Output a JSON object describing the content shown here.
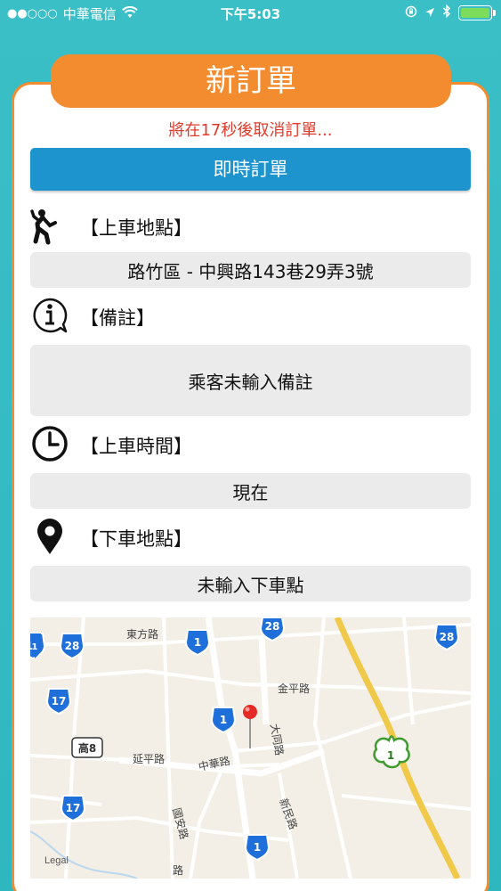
{
  "status_bar": {
    "signal": "●●○○○",
    "carrier": "中華電信",
    "time": "下午5:03"
  },
  "title": "新訂單",
  "countdown": "將在17秒後取消訂單...",
  "order_type": "即時訂單",
  "pickup": {
    "label": "【上車地點】",
    "value": "路竹區 - 中興路143巷29弄3號",
    "icon": "person-waving-icon"
  },
  "note": {
    "label": "【備註】",
    "value": "乘客未輸入備註",
    "icon": "info-icon"
  },
  "pickup_time": {
    "label": "【上車時間】",
    "value": "現在",
    "icon": "clock-icon"
  },
  "dropoff": {
    "label": "【下車地點】",
    "value": "未輸入下車點",
    "icon": "location-pin-icon"
  },
  "map": {
    "legal": "Legal",
    "roads": [
      "東方路",
      "金平路",
      "延平路",
      "中華路",
      "大同路",
      "新民路",
      "國安路",
      "路"
    ],
    "shields": [
      "17",
      "28",
      "1",
      "28",
      "28",
      "17",
      "1",
      "高8",
      "1",
      "17",
      "1",
      "1"
    ]
  },
  "colors": {
    "accent": "#f28c2e",
    "button": "#1e94cf",
    "warning": "#e03a2a",
    "background": "#3bbfc7"
  }
}
